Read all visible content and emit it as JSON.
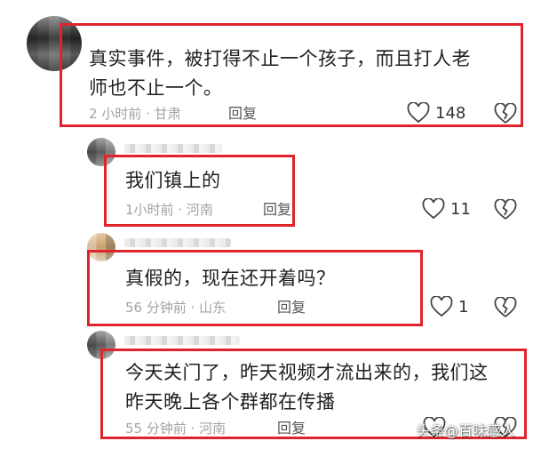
{
  "comments": [
    {
      "text_lines": [
        "真实事件，被打得不止一个孩子，而且打人老",
        "师也不止一个。"
      ],
      "meta": "2 小时前 · 甘肃",
      "reply_label": "回复",
      "likes": "148"
    },
    {
      "text_lines": [
        "我们镇上的"
      ],
      "meta": "1小时前 · 河南",
      "reply_label": "回复",
      "likes": "11"
    },
    {
      "text_lines": [
        "真假的，现在还开着吗？"
      ],
      "meta": "56 分钟前 · 山东",
      "reply_label": "回复",
      "likes": "1"
    },
    {
      "text_lines": [
        "今天关门了，昨天视频才流出来的，我们这",
        "昨天晚上各个群都在传播"
      ],
      "meta": "55 分钟前 · 河南",
      "reply_label": "回复",
      "likes": ""
    }
  ],
  "watermark": "头条@百味感人",
  "colors": {
    "highlight_border": "#e0242b",
    "meta_text": "#a3a3a3"
  }
}
